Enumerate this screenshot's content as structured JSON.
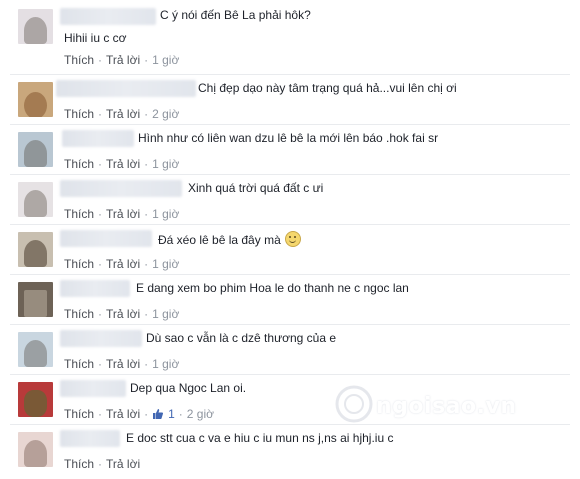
{
  "actions": {
    "like": "Thích",
    "reply": "Trả lời",
    "separator": "·"
  },
  "comments": [
    {
      "name_hidden": true,
      "text": "C ý nói đến Bê La phải hôk?",
      "text2": "Hihii iu c cơ",
      "time": "1 giờ"
    },
    {
      "name_hidden": true,
      "text": "Chị đẹp dạo này tâm trạng quá hả...vui lên chị ơi",
      "time": "2 giờ"
    },
    {
      "name_hidden": true,
      "text": "Hình như có liên wan dzu lê bê la mới lên báo .hok fai sr",
      "time": "1 giờ"
    },
    {
      "name_hidden": true,
      "text": "Xinh quá trời quá đất c ưi",
      "time": "1 giờ"
    },
    {
      "name_hidden": true,
      "text": "Đá xéo lê bê la đây mà",
      "emoji": "smile-emoji",
      "time": "1 giờ"
    },
    {
      "name_hidden": true,
      "text": "E dang xem bo phim Hoa le do thanh ne c ngoc lan",
      "time": "1 giờ"
    },
    {
      "name_hidden": true,
      "text": "Dù sao c vẫn là c dzê thương của e",
      "time": "1 giờ"
    },
    {
      "name_hidden": true,
      "text": "Dep qua Ngoc Lan oi.",
      "likes": "1",
      "time": "2 giờ"
    },
    {
      "name_hidden": true,
      "text": "E doc stt cua c va e hiu c iu mun ns j,ns ai hjhj.iu c",
      "time": ""
    }
  ],
  "watermark": {
    "text": "ngoisao.vn"
  },
  "colors": {
    "text": "#1d2129",
    "action": "#4b4f56",
    "muted": "#8d949e",
    "like_blue": "#4267b2",
    "divider": "#e9ebee"
  }
}
